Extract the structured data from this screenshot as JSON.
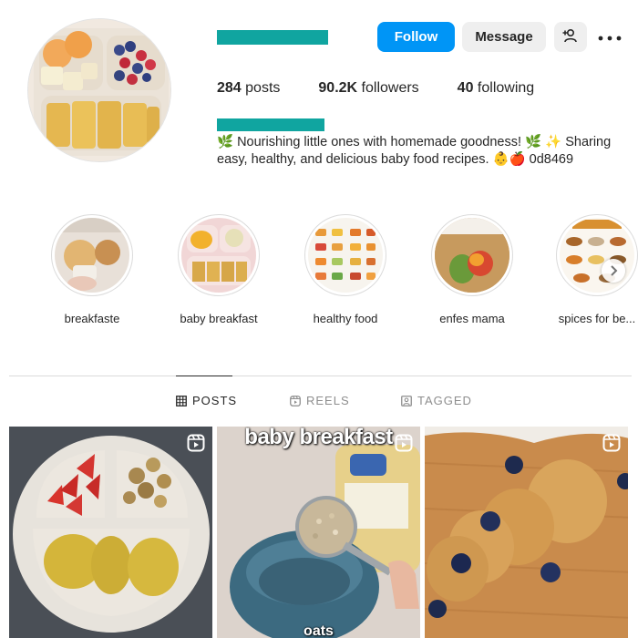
{
  "profile": {
    "follow_label": "Follow",
    "message_label": "Message"
  },
  "stats": {
    "posts_count": "284",
    "posts_label": " posts",
    "followers_count": "90.2K",
    "followers_label": " followers",
    "following_count": "40",
    "following_label": " following"
  },
  "bio": {
    "line1": "🌿 Nourishing little ones with homemade goodness! 🌿 ✨ Sharing easy, healthy, and delicious baby food recipes. 👶🍎 0d8469"
  },
  "highlights": [
    {
      "label": "breakfaste"
    },
    {
      "label": "baby breakfast"
    },
    {
      "label": "healthy food"
    },
    {
      "label": "enfes mama"
    },
    {
      "label": "spices for be..."
    }
  ],
  "tabs": [
    {
      "label": "POSTS",
      "icon": "grid-icon",
      "active": true
    },
    {
      "label": "REELS",
      "icon": "reels-icon",
      "active": false
    },
    {
      "label": "TAGGED",
      "icon": "tagged-icon",
      "active": false
    }
  ],
  "posts": [
    {
      "type": "reel",
      "caption": ""
    },
    {
      "type": "reel",
      "caption": "baby breakfast",
      "bottom_caption": "oats"
    },
    {
      "type": "reel",
      "caption": ""
    }
  ],
  "colors": {
    "accent": "#0095f6",
    "redacted": "#10a5a0"
  }
}
